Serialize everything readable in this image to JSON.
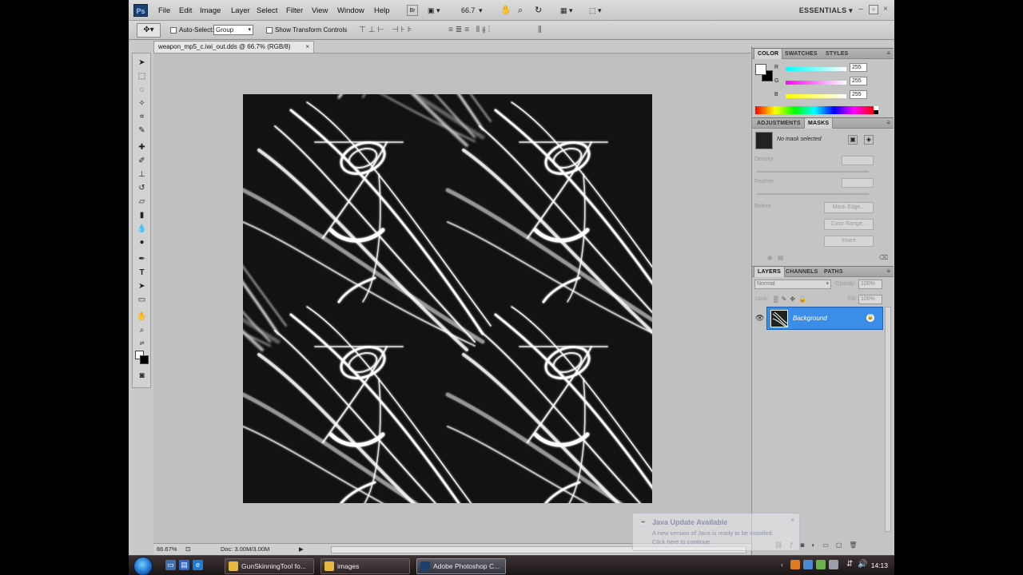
{
  "app": {
    "logo": "Ps",
    "menu": [
      "File",
      "Edit",
      "Image",
      "Layer",
      "Select",
      "Filter",
      "View",
      "Window",
      "Help"
    ],
    "zoom_value": "66.7",
    "workspace": "ESSENTIALS"
  },
  "options": {
    "auto_select_label": "Auto-Select:",
    "auto_select_value": "Group",
    "show_transform_label": "Show Transform Controls"
  },
  "document": {
    "tab_title": "weapon_mp5_c.iwi_out.dds @ 66.7% (RGB/8)",
    "close": "×"
  },
  "status": {
    "zoom": "66.67%",
    "doc_size": "Doc: 3.00M/3.00M"
  },
  "panels": {
    "color": {
      "tabs": [
        "COLOR",
        "SWATCHES",
        "STYLES"
      ],
      "channels": [
        {
          "label": "R",
          "value": "255"
        },
        {
          "label": "G",
          "value": "255"
        },
        {
          "label": "B",
          "value": "255"
        }
      ]
    },
    "adjustments": {
      "tabs": [
        "ADJUSTMENTS",
        "MASKS"
      ],
      "no_mask": "No mask selected",
      "density_label": "Density:",
      "feather_label": "Feather:",
      "refine_label": "Refine:",
      "buttons": [
        "Mask Edge...",
        "Color Range...",
        "Invert"
      ]
    },
    "layers": {
      "tabs": [
        "LAYERS",
        "CHANNELS",
        "PATHS"
      ],
      "blend_mode": "Normal",
      "opacity_label": "Opacity:",
      "opacity_value": "100%",
      "lock_label": "Lock:",
      "fill_label": "Fill:",
      "fill_value": "100%",
      "layer_name": "Background"
    }
  },
  "notification": {
    "title": "Java Update Available",
    "line1": "A new version of Java is ready to be installed.",
    "line2": "Click here to continue."
  },
  "taskbar": {
    "tasks": [
      {
        "label": "GunSkinningTool fo..."
      },
      {
        "label": "images"
      },
      {
        "label": "Adobe Photoshop C..."
      }
    ],
    "clock": "14:13"
  },
  "colors": {
    "selection": "#3a8ee8",
    "taskbar": "#2a2122"
  }
}
